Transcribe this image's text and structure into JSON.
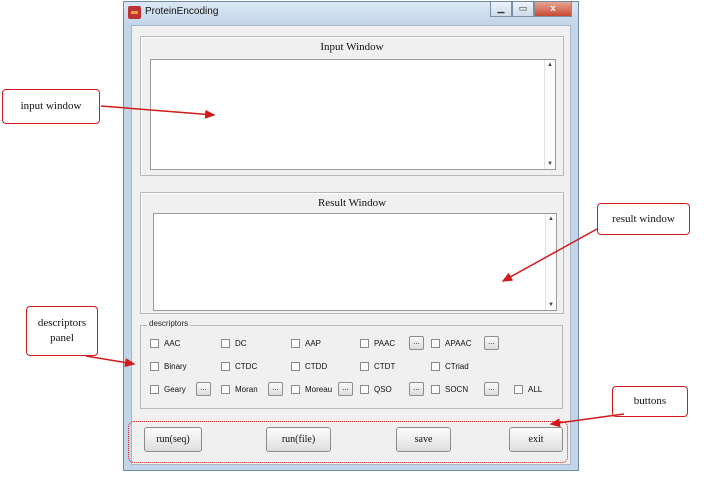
{
  "window": {
    "title": "ProteinEncoding",
    "close_glyph": "x"
  },
  "input_panel": {
    "title": "Input Window",
    "value": ""
  },
  "result_panel": {
    "title": "Result Window",
    "value": ""
  },
  "descriptors": {
    "legend": "descriptors",
    "row1": [
      "AAC",
      "DC",
      "AAP",
      "PAAC",
      "APAAC"
    ],
    "row2": [
      "Binary",
      "CTDC",
      "CTDD",
      "CTDT",
      "CTriad"
    ],
    "row3": [
      "Geary",
      "Moran",
      "Moreau",
      "QSO",
      "SOCN",
      "ALL"
    ],
    "ellipsis": "..."
  },
  "buttons": {
    "run_seq": "run(seq)",
    "run_file": "run(file)",
    "save": "save",
    "exit": "exit"
  },
  "annotations": {
    "input_window": "input window",
    "result_window": "result window",
    "descriptors_panel_1": "descriptors",
    "descriptors_panel_2": "panel",
    "buttons": "buttons"
  },
  "colors": {
    "annotation": "#d21a1a",
    "window_frame": "#c3d5ea"
  }
}
